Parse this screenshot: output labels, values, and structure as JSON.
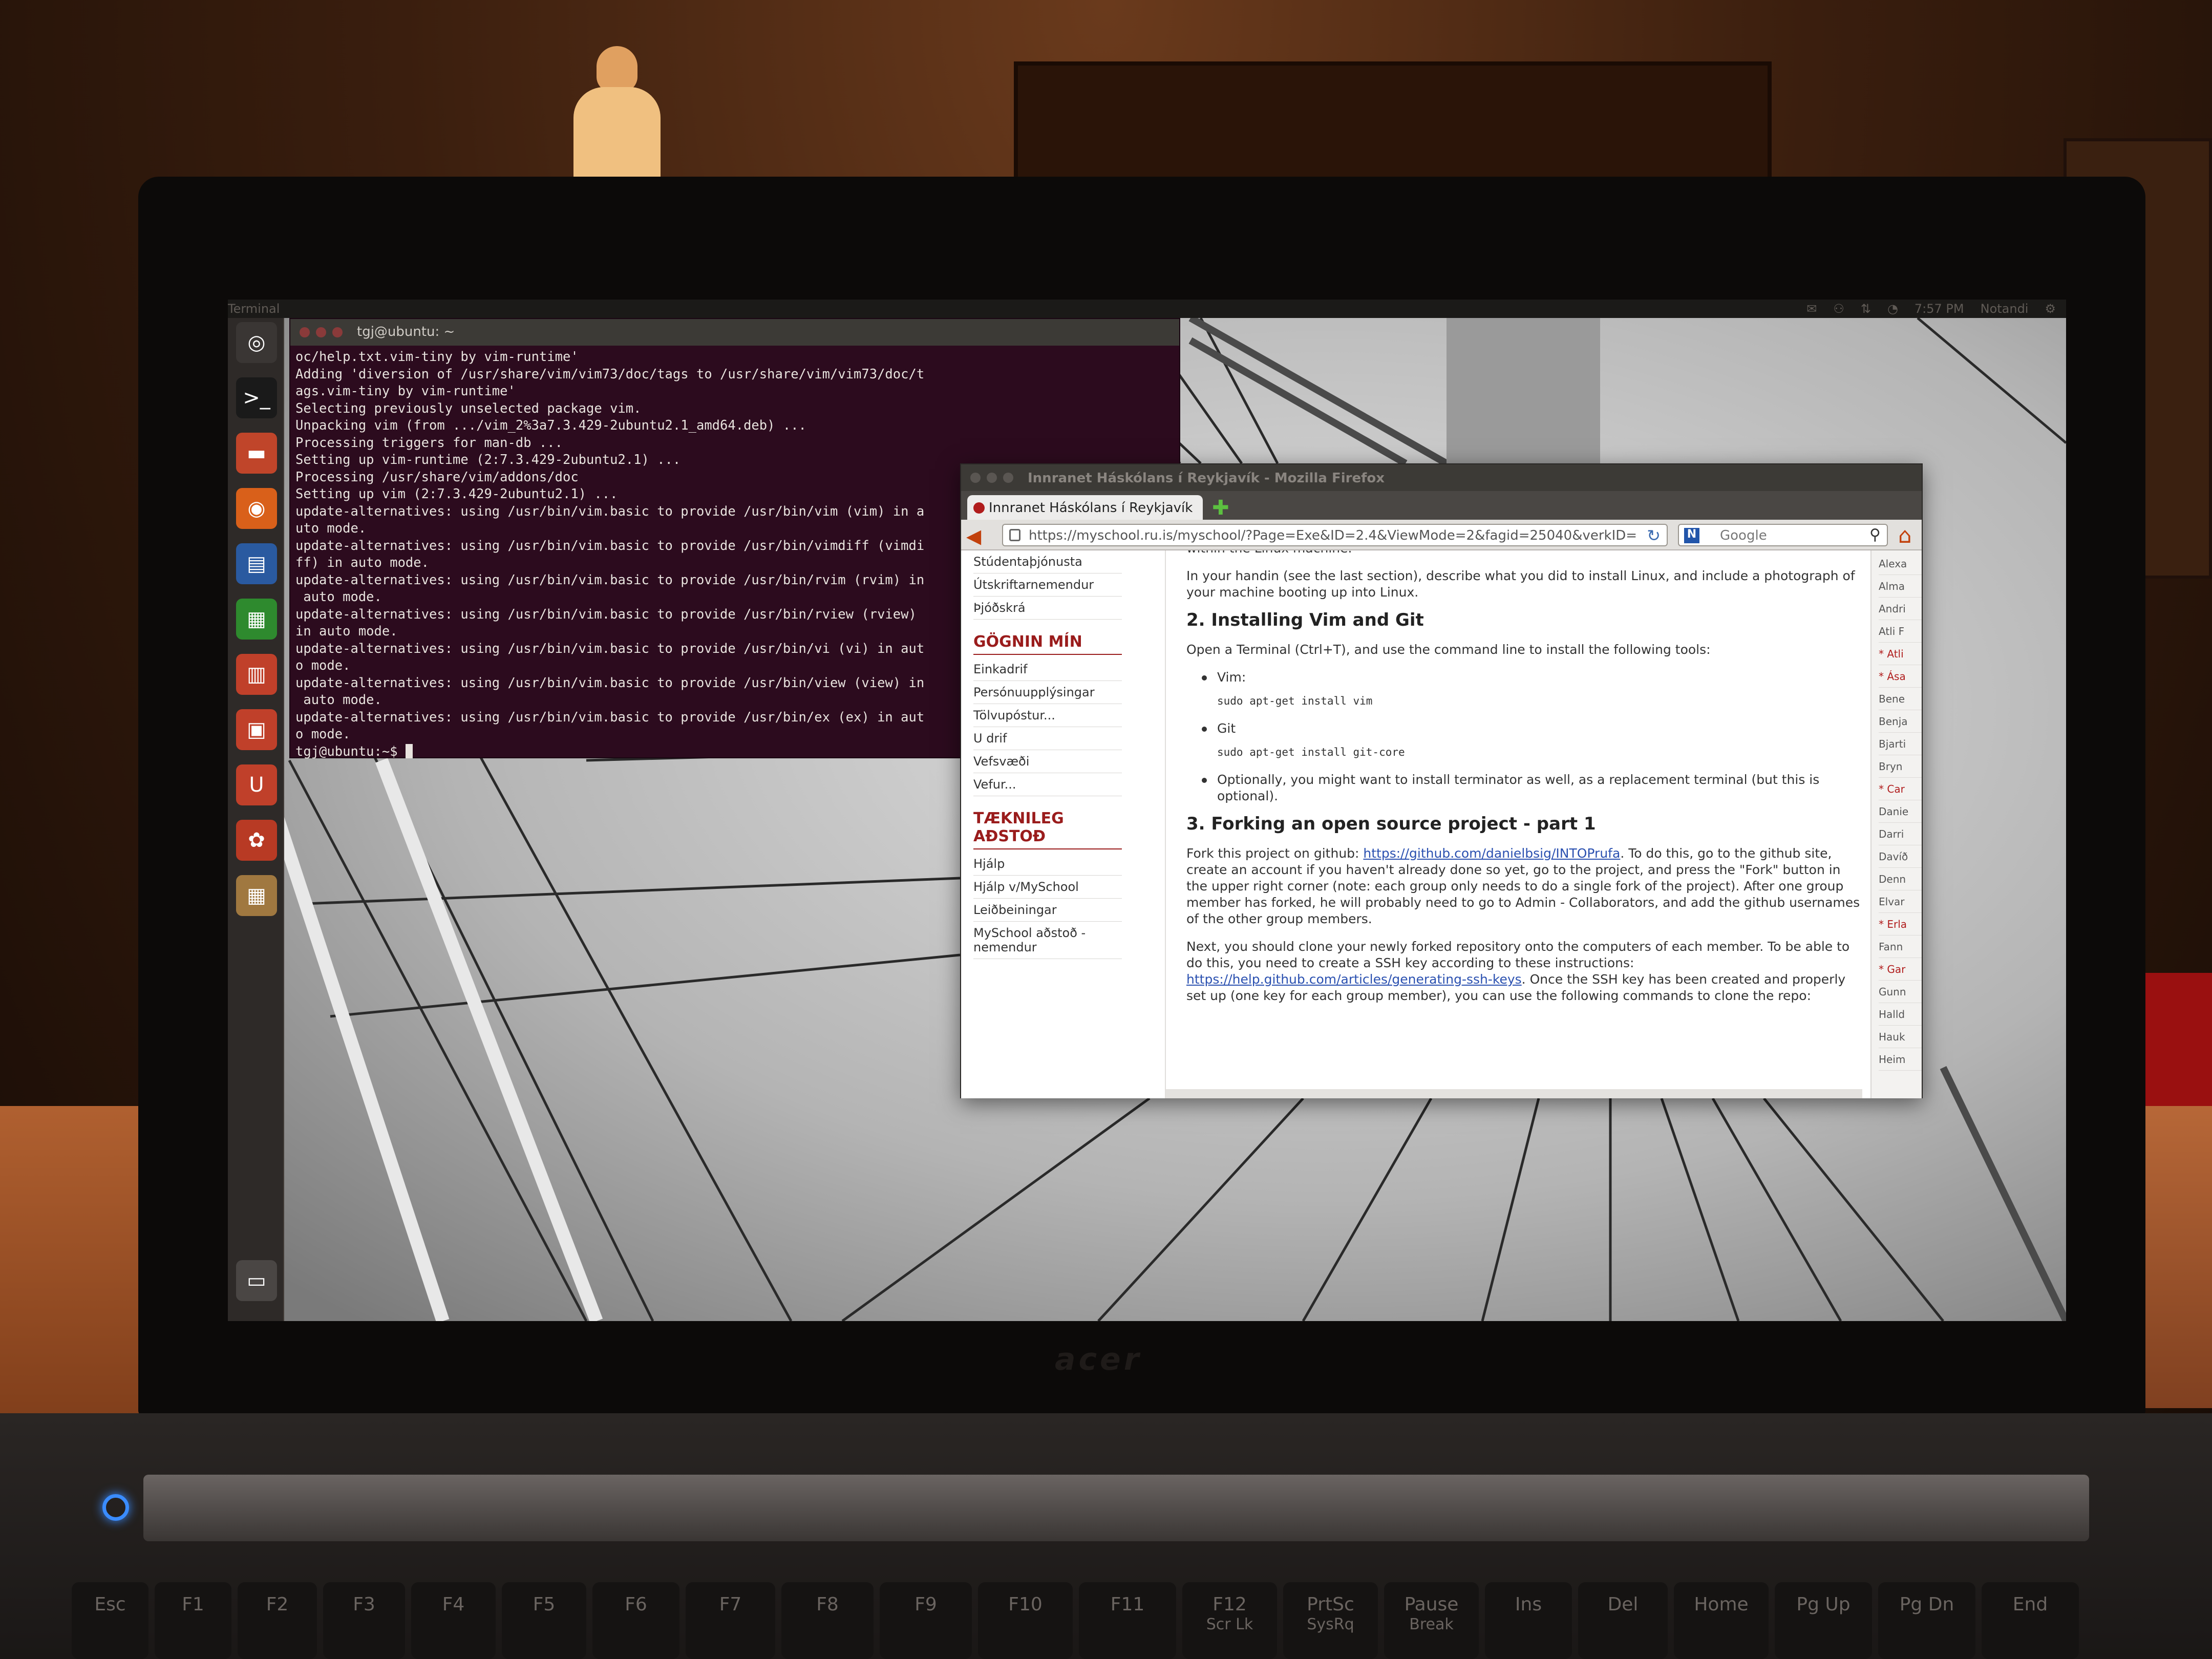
{
  "panel": {
    "app_title": "Terminal",
    "indicators": [
      "✉",
      "⚇",
      "⇅",
      "◔",
      "7:57 PM",
      "Notandi",
      "⚙"
    ]
  },
  "launcher": [
    {
      "name": "dash-icon",
      "glyph": "◎",
      "color": "#3a3634"
    },
    {
      "name": "terminal-icon",
      "glyph": ">_",
      "color": "#1a1a1a"
    },
    {
      "name": "files-icon",
      "glyph": "▬",
      "color": "#c0452a"
    },
    {
      "name": "firefox-icon",
      "glyph": "◉",
      "color": "#d9601a"
    },
    {
      "name": "writer-icon",
      "glyph": "▤",
      "color": "#2a5aa0"
    },
    {
      "name": "calc-icon",
      "glyph": "▦",
      "color": "#2e8a2e"
    },
    {
      "name": "impress-icon",
      "glyph": "▥",
      "color": "#c0402a"
    },
    {
      "name": "software-center-icon",
      "glyph": "▣",
      "color": "#c0402a"
    },
    {
      "name": "ubuntu-one-icon",
      "glyph": "U",
      "color": "#c0402a"
    },
    {
      "name": "settings-icon",
      "glyph": "✿",
      "color": "#b83a24"
    },
    {
      "name": "workspaces-icon",
      "glyph": "▦",
      "color": "#a07840"
    },
    {
      "name": "trash-icon",
      "glyph": "▭",
      "color": "#4a4644"
    }
  ],
  "terminal": {
    "title": "tgj@ubuntu: ~",
    "lines": [
      "oc/help.txt.vim-tiny by vim-runtime'",
      "Adding 'diversion of /usr/share/vim/vim73/doc/tags to /usr/share/vim/vim73/doc/t",
      "ags.vim-tiny by vim-runtime'",
      "Selecting previously unselected package vim.",
      "Unpacking vim (from .../vim_2%3a7.3.429-2ubuntu2.1_amd64.deb) ...",
      "Processing triggers for man-db ...",
      "Setting up vim-runtime (2:7.3.429-2ubuntu2.1) ...",
      "Processing /usr/share/vim/addons/doc",
      "Setting up vim (2:7.3.429-2ubuntu2.1) ...",
      "update-alternatives: using /usr/bin/vim.basic to provide /usr/bin/vim (vim) in a",
      "uto mode.",
      "update-alternatives: using /usr/bin/vim.basic to provide /usr/bin/vimdiff (vimdi",
      "ff) in auto mode.",
      "update-alternatives: using /usr/bin/vim.basic to provide /usr/bin/rvim (rvim) in",
      " auto mode.",
      "update-alternatives: using /usr/bin/vim.basic to provide /usr/bin/rview (rview)",
      "in auto mode.",
      "update-alternatives: using /usr/bin/vim.basic to provide /usr/bin/vi (vi) in aut",
      "o mode.",
      "update-alternatives: using /usr/bin/vim.basic to provide /usr/bin/view (view) in",
      " auto mode.",
      "update-alternatives: using /usr/bin/vim.basic to provide /usr/bin/ex (ex) in aut",
      "o mode."
    ],
    "prompt": "tgj@ubuntu:~$ "
  },
  "firefox": {
    "window_title": "Innranet Háskólans í Reykjavík - Mozilla Firefox",
    "tab_label": "Innranet Háskólans í Reykjavík",
    "url": "https://myschool.ru.is/myschool/?Page=Exe&ID=2.4&ViewMode=2&fagid=25040&verkID=",
    "search_placeholder": "Google",
    "search_engine_glyph": "N"
  },
  "sidenav": {
    "top_items": [
      "Stúdentaþjónusta",
      "Útskriftarnemendur",
      "Þjóðskrá"
    ],
    "section1_title": "GÖGNIN MÍN",
    "section1_items": [
      "Einkadrif",
      "Persónuupplýsingar",
      "Tölvupóstur...",
      "U drif",
      "Vefsvæði",
      "Vefur..."
    ],
    "section2_title": "TÆKNILEG AÐSTOÐ",
    "section2_items": [
      "Hjálp",
      "Hjálp v/MySchool",
      "Leiðbeiningar",
      "MySchool aðstoð - nemendur"
    ]
  },
  "article": {
    "fragment": "within the Linux machine.",
    "handin_text": "In your handin (see the last section), describe what you did to install Linux, and include a photograph of your machine booting up into Linux.",
    "h2_vim_git": "2. Installing Vim and Git",
    "vim_git_intro": "Open a Terminal (Ctrl+T), and use the command line to install the following tools:",
    "tool1": "Vim:",
    "tool1_cmd": "sudo apt-get install vim",
    "tool2": "Git",
    "tool2_cmd": "sudo apt-get install git-core",
    "tool3": "Optionally, you might want to install terminator as well, as a replacement terminal (but this is optional).",
    "h2_fork": "3. Forking an open source project - part 1",
    "fork_p1_before": "Fork this project on github: ",
    "fork_link": "https://github.com/danielbsig/INTOPrufa",
    "fork_p1_after": ". To do this, go to the github site, create an account if you haven't already done so yet, go to the project, and press the \"Fork\" button in the upper right corner (note: each group only needs to do a single fork of the project). After one group member has forked, he will probably need to go to Admin - Collaborators, and add the github usernames of the other group members.",
    "clone_p_before": "Next, you should clone your newly forked repository onto the computers of each member. To be able to do this, you need to create a SSH key according to these instructions: ",
    "ssh_link": "https://help.github.com/articles/generating-ssh-keys",
    "clone_p_after": ". Once the SSH key has been created and properly set up (one key for each group member), you can use the following commands to clone the repo:"
  },
  "rightcol": [
    {
      "text": "Alexa",
      "red": false
    },
    {
      "text": "Alma",
      "red": false
    },
    {
      "text": "Andri",
      "red": false
    },
    {
      "text": "Atli F",
      "red": false
    },
    {
      "text": "* Atli",
      "red": true
    },
    {
      "text": "* Ása",
      "red": true
    },
    {
      "text": "Bene",
      "red": false
    },
    {
      "text": "Benja",
      "red": false
    },
    {
      "text": "Bjarti",
      "red": false
    },
    {
      "text": "Bryn",
      "red": false
    },
    {
      "text": "* Car",
      "red": true
    },
    {
      "text": "Danie",
      "red": false
    },
    {
      "text": "Darri",
      "red": false
    },
    {
      "text": "Davíð",
      "red": false
    },
    {
      "text": "Denn",
      "red": false
    },
    {
      "text": "Elvar",
      "red": false
    },
    {
      "text": "* Erla",
      "red": true
    },
    {
      "text": "Fann",
      "red": false
    },
    {
      "text": "* Gar",
      "red": true
    },
    {
      "text": "Gunn",
      "red": false
    },
    {
      "text": "Halld",
      "red": false
    },
    {
      "text": "Hauk",
      "red": false
    },
    {
      "text": "Heim",
      "red": false
    }
  ],
  "keyboard": [
    {
      "label": "Esc",
      "sub": ""
    },
    {
      "label": "F1",
      "sub": ""
    },
    {
      "label": "F2",
      "sub": ""
    },
    {
      "label": "F3",
      "sub": ""
    },
    {
      "label": "F4",
      "sub": ""
    },
    {
      "label": "F5",
      "sub": ""
    },
    {
      "label": "F6",
      "sub": ""
    },
    {
      "label": "F7",
      "sub": ""
    },
    {
      "label": "F8",
      "sub": ""
    },
    {
      "label": "F9",
      "sub": ""
    },
    {
      "label": "F10",
      "sub": ""
    },
    {
      "label": "F11",
      "sub": ""
    },
    {
      "label": "F12",
      "sub": "Scr Lk"
    },
    {
      "label": "PrtSc",
      "sub": "SysRq"
    },
    {
      "label": "Pause",
      "sub": "Break"
    },
    {
      "label": "Ins",
      "sub": ""
    },
    {
      "label": "Del",
      "sub": ""
    },
    {
      "label": "Home",
      "sub": ""
    },
    {
      "label": "Pg Up",
      "sub": ""
    },
    {
      "label": "Pg Dn",
      "sub": ""
    },
    {
      "label": "End",
      "sub": ""
    }
  ]
}
